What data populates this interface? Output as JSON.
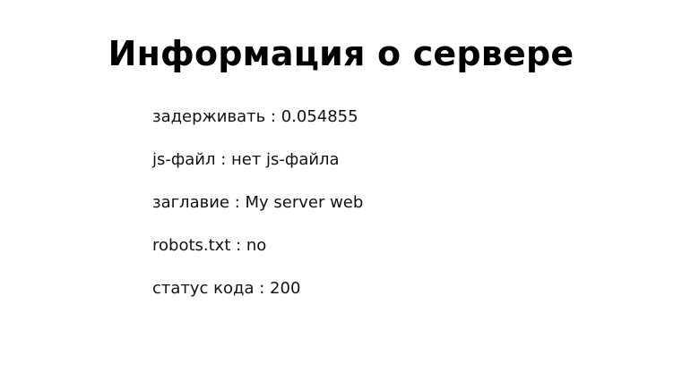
{
  "page": {
    "title": "Информация о сервере"
  },
  "info": {
    "rows": [
      {
        "text": "задерживать : 0.054855"
      },
      {
        "text": "js-файл : нет js-файла"
      },
      {
        "text": "заглавие : My server web"
      },
      {
        "text": "robots.txt : no"
      },
      {
        "text": "статус кода : 200"
      }
    ]
  },
  "colors": {
    "background": "#ffffff",
    "text": "#000000"
  }
}
